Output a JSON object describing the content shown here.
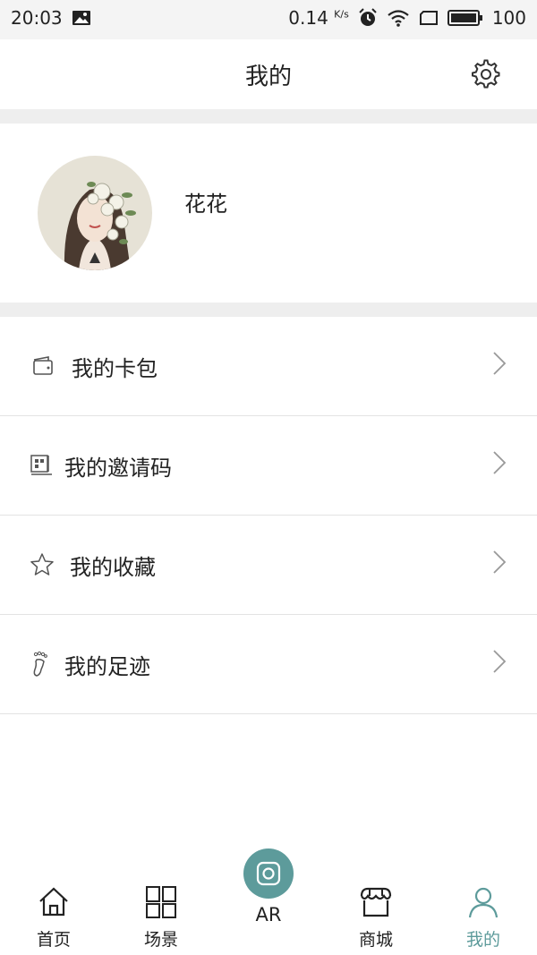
{
  "status_bar": {
    "time": "20:03",
    "speed": "0.14",
    "speed_unit": "K/s",
    "battery": "100",
    "icons": [
      "image-icon",
      "alarm-icon",
      "wifi-icon",
      "screen-icon",
      "battery-icon"
    ]
  },
  "header": {
    "title": "我的",
    "settings_icon": "gear-icon"
  },
  "profile": {
    "name": "花花",
    "avatar_icon": "avatar-illustration"
  },
  "menu": {
    "items": [
      {
        "label": "我的卡包",
        "icon": "wallet-icon"
      },
      {
        "label": "我的邀请码",
        "icon": "qrcode-icon"
      },
      {
        "label": "我的收藏",
        "icon": "star-icon"
      },
      {
        "label": "我的足迹",
        "icon": "footprint-icon"
      }
    ]
  },
  "bottom_nav": {
    "items": [
      {
        "label": "首页",
        "icon": "home-icon",
        "active": false
      },
      {
        "label": "场景",
        "icon": "grid-icon",
        "active": false
      },
      {
        "label": "AR",
        "icon": "camera-icon",
        "active": false
      },
      {
        "label": "商城",
        "icon": "store-icon",
        "active": false
      },
      {
        "label": "我的",
        "icon": "user-icon",
        "active": true
      }
    ]
  },
  "colors": {
    "accent": "#5d9b9b",
    "divider_band": "#eeeeee",
    "status_bar_bg": "#f4f4f4"
  }
}
